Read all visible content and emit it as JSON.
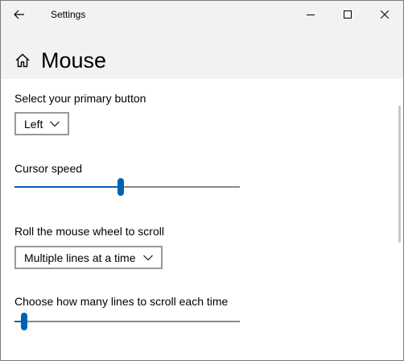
{
  "window": {
    "title": "Settings"
  },
  "header": {
    "title": "Mouse"
  },
  "primary_button": {
    "label": "Select your primary button",
    "value": "Left"
  },
  "cursor_speed": {
    "label": "Cursor speed",
    "level_fraction": 0.47
  },
  "scroll_mode": {
    "label": "Roll the mouse wheel to scroll",
    "value": "Multiple lines at a time"
  },
  "scroll_lines": {
    "label": "Choose how many lines to scroll each time",
    "level_fraction": 0.03
  },
  "colors": {
    "accent": "#0063b1",
    "titlebar_bg": "#f2f2f2"
  },
  "icons": {
    "back": "back-arrow-icon",
    "minimize": "minimize-icon",
    "maximize": "maximize-icon",
    "close": "close-icon",
    "home": "home-icon",
    "dropdown": "chevron-down-icon"
  }
}
